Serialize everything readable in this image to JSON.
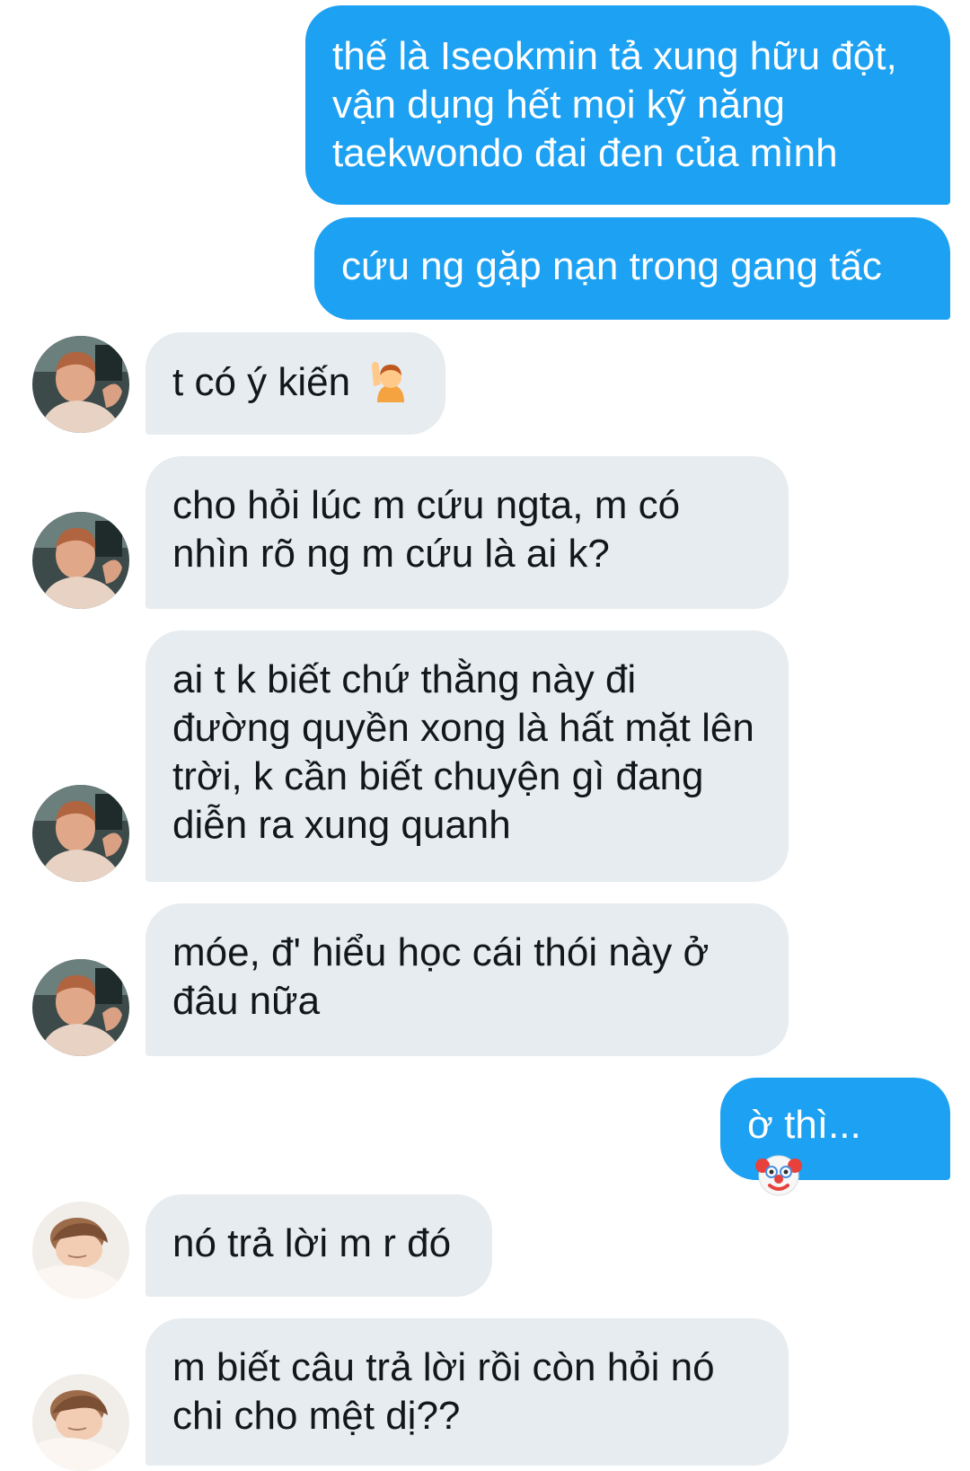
{
  "messages": [
    {
      "side": "out",
      "text": "thế là Iseokmin tả xung hữu đột, vận dụng hết mọi kỹ năng taekwondo đai đen của mình"
    },
    {
      "side": "out",
      "text": "cứu ng gặp nạn trong gang tấc"
    },
    {
      "side": "in",
      "text": "t có ý kiến",
      "emoji": "person-raising-hand-emoji",
      "avatar": "avatar-boy-a"
    },
    {
      "side": "in",
      "text": "cho hỏi lúc m cứu ngta, m có nhìn rõ ng m cứu là ai k?",
      "avatar": "avatar-boy-a"
    },
    {
      "side": "in",
      "text": "ai t k biết chứ thằng này đi đường quyền xong là hất mặt lên trời, k cần biết chuyện gì đang diễn ra xung quanh",
      "avatar": "avatar-boy-a"
    },
    {
      "side": "in",
      "text": "móe, đ' hiểu học cái thói này ở đâu nữa",
      "avatar": "avatar-boy-a"
    },
    {
      "side": "out",
      "text": "ờ thì...",
      "emoji": "clown-face-emoji"
    },
    {
      "side": "in",
      "text": "nó trả lời m r đó",
      "avatar": "avatar-boy-b"
    },
    {
      "side": "in",
      "text": "m biết câu trả lời rồi còn hỏi nó chi cho mệt dị??",
      "avatar": "avatar-boy-b"
    }
  ],
  "colors": {
    "outgoing_bubble": "#1da1f2",
    "incoming_bubble": "#e6ecf0",
    "outgoing_text": "#ffffff",
    "incoming_text": "#14171a"
  }
}
